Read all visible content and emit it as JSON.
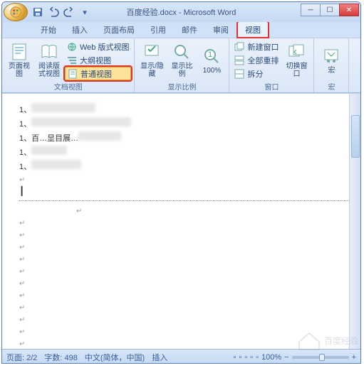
{
  "titlebar": {
    "doc_title": "百度经验.docx - Microsoft Word"
  },
  "tabs": {
    "items": [
      "开始",
      "插入",
      "页面布局",
      "引用",
      "邮件",
      "审阅",
      "视图"
    ],
    "active_index": 6,
    "highlighted_index": 6
  },
  "ribbon": {
    "group1": {
      "label": "文档视图",
      "page_layout": "页面视图",
      "reading": "阅读版式视图",
      "web": "Web 版式视图",
      "outline": "大纲视图",
      "normal": "普通视图"
    },
    "group2": {
      "label": "显示比例",
      "show_hide": "显示/隐藏",
      "zoom": "显示比例",
      "hundred": "100%"
    },
    "group3": {
      "label": "窗口",
      "new_window": "新建窗口",
      "arrange_all": "全部重排",
      "split": "拆分",
      "switch": "切换窗口"
    },
    "group4": {
      "label": "宏",
      "macros": "宏"
    }
  },
  "document": {
    "visible_text_fragment": "百…显目展…",
    "lines": [
      {
        "num": "1、",
        "blur_w": 90
      },
      {
        "num": "1、",
        "blur_w": 140
      },
      {
        "num": "1、",
        "blur_w": 120
      },
      {
        "num": "1、",
        "blur_w": 50
      },
      {
        "num": "1、",
        "blur_w": 70
      }
    ]
  },
  "statusbar": {
    "page": "页面: 2/2",
    "words": "字数: 498",
    "lang": "中文(简体，中国)",
    "mode": "插入",
    "zoom": "100%"
  },
  "watermark": "百度经验"
}
